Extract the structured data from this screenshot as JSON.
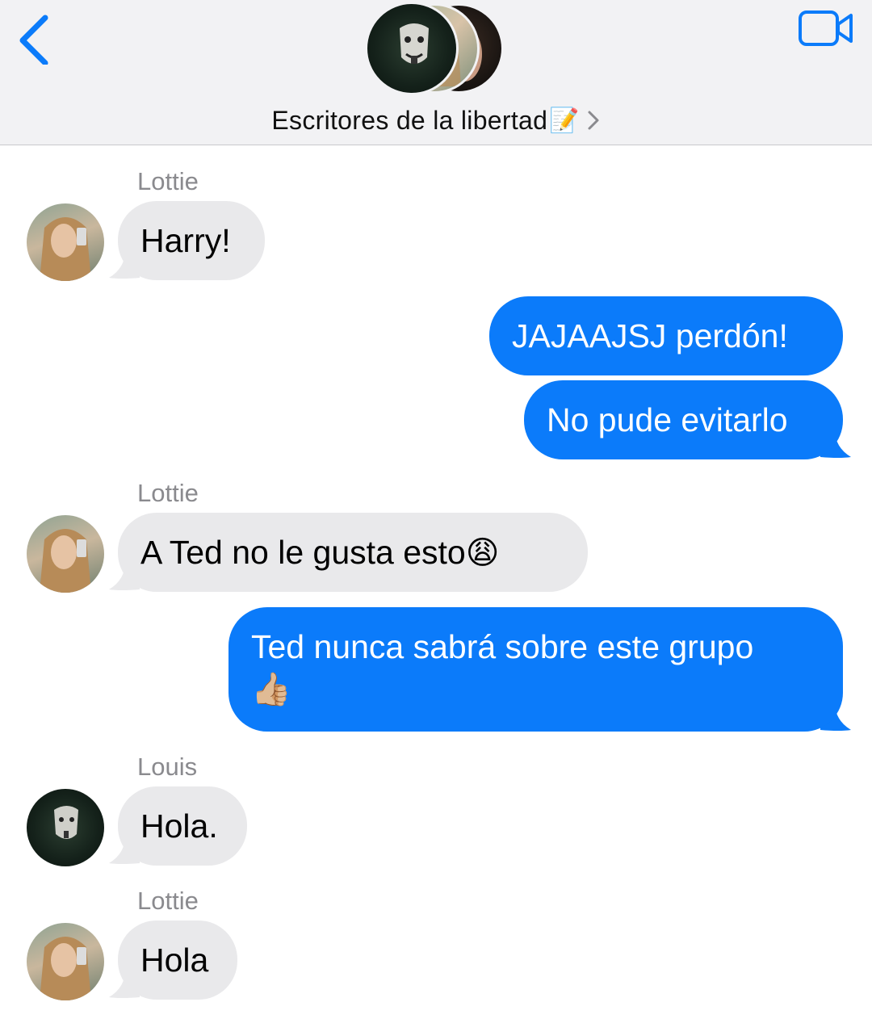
{
  "header": {
    "group_title": "Escritores de la libertad",
    "group_title_emoji": "📝"
  },
  "colors": {
    "accent": "#0b7bfa",
    "sent_bubble": "#0b7bfa",
    "received_bubble": "#e9e9eb",
    "sender_name": "#8a8a8e",
    "header_bg": "#f2f2f4"
  },
  "icons": {
    "back": "chevron-left-icon",
    "video": "video-camera-icon",
    "title_chevron": "chevron-right-icon"
  },
  "messages": [
    {
      "sender": "Lottie",
      "text": "Harry!",
      "direction": "received"
    },
    {
      "text": "JAJAAJSJ perdón!",
      "direction": "sent"
    },
    {
      "text": "No pude evitarlo",
      "direction": "sent"
    },
    {
      "sender": "Lottie",
      "text": "A Ted no le gusta esto",
      "emoji": "😩",
      "direction": "received"
    },
    {
      "text": "Ted nunca sabrá sobre este grupo",
      "emoji": "👍🏼",
      "direction": "sent"
    },
    {
      "sender": "Louis",
      "text": "Hola.",
      "direction": "received"
    },
    {
      "sender": "Lottie",
      "text": "Hola",
      "direction": "received"
    }
  ]
}
